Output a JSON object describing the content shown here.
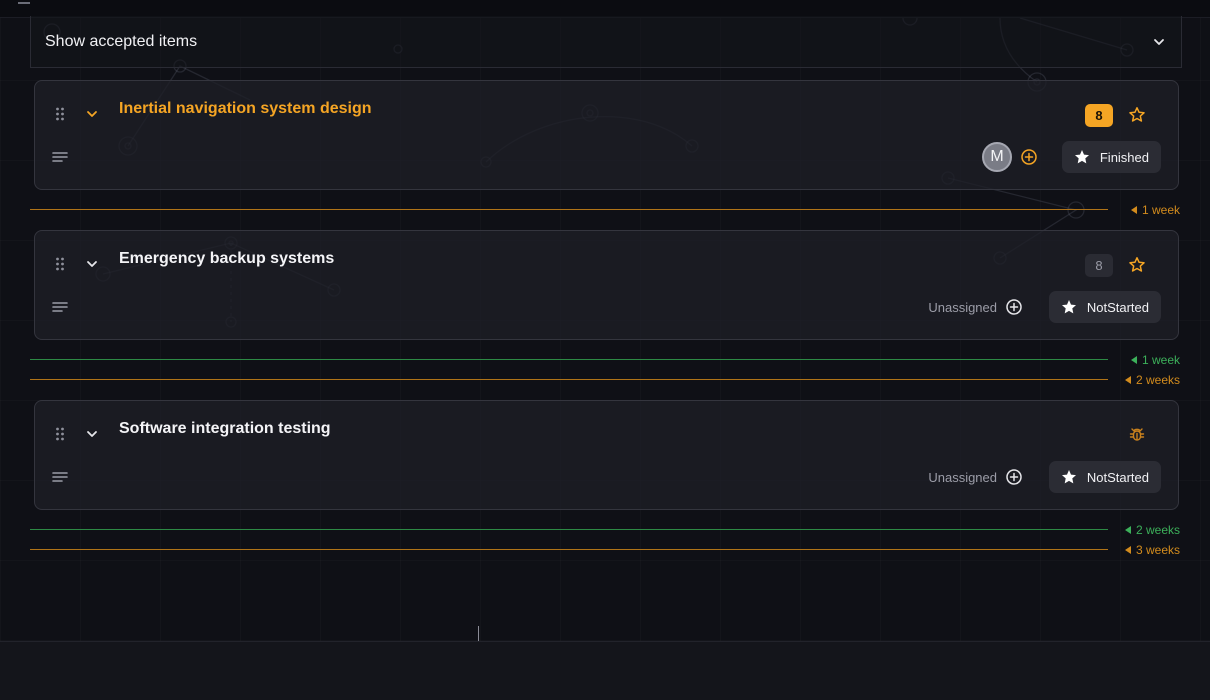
{
  "accepted_toggle": {
    "label": "Show accepted items"
  },
  "colors": {
    "accent": "#f5a524",
    "green": "#3cb05a",
    "orange_marker": "#d28b1d"
  },
  "items": [
    {
      "title": "Inertial navigation system design",
      "points": "8",
      "assignee_initial": "M",
      "status": "Finished",
      "icon": "star-outline-icon"
    },
    {
      "title": "Emergency backup systems",
      "points": "8",
      "assignee_label": "Unassigned",
      "status": "NotStarted",
      "icon": "star-outline-icon"
    },
    {
      "title": "Software integration testing",
      "assignee_label": "Unassigned",
      "status": "NotStarted",
      "icon": "bug-icon"
    }
  ],
  "markers": [
    {
      "label": "1 week",
      "color": "orange"
    },
    {
      "label": "1 week",
      "color": "green"
    },
    {
      "label": "2 weeks",
      "color": "orange"
    },
    {
      "label": "2 weeks",
      "color": "green"
    },
    {
      "label": "3 weeks",
      "color": "orange"
    }
  ]
}
